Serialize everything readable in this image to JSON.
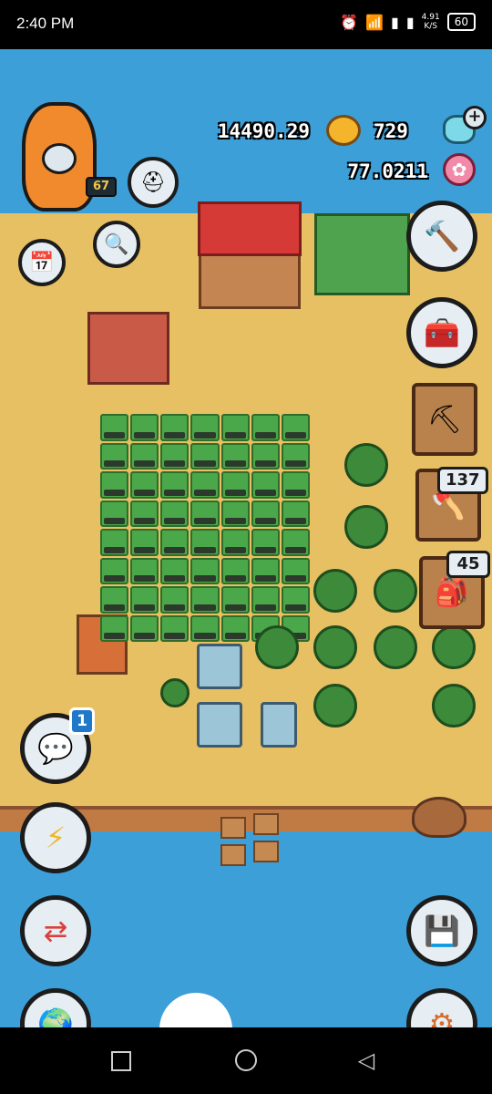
{
  "status_bar": {
    "time": "2:40 PM",
    "speed_value": "4.91",
    "speed_unit": "K/S",
    "battery": "60",
    "icons": [
      "alarm-icon",
      "wifi-icon",
      "signal-icon",
      "signal-icon"
    ]
  },
  "hud": {
    "level": "67",
    "coins": "14490.29",
    "gems": "729",
    "flowers": "77.0211",
    "gems_plus": "+"
  },
  "tools": {
    "axe_count": "137",
    "bag_count": "45"
  },
  "notifications": {
    "chat_badge": "1"
  },
  "colors": {
    "water": "#3d9fd8",
    "sand": "#e8c064",
    "crop": "#4ba84a",
    "roof": "#d63a36",
    "badge": "#1f78c8"
  }
}
